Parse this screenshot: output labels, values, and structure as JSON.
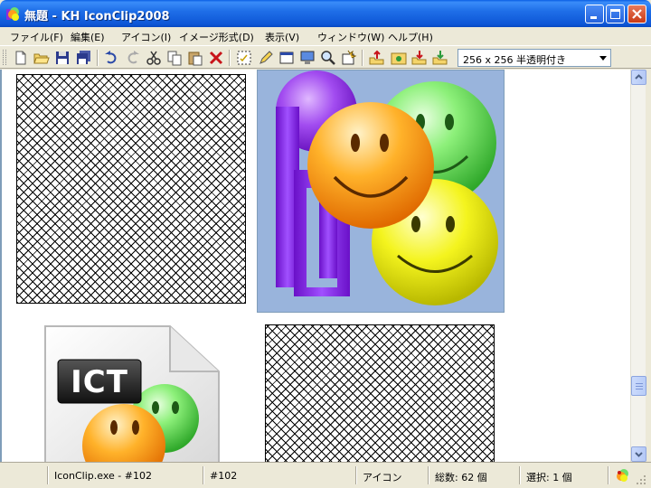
{
  "window": {
    "title": "無題 - KH IconClip2008",
    "minimize_glyph": "_",
    "maximize_glyph": "□",
    "close_glyph": "×"
  },
  "menu": [
    {
      "label": "ファイル(F)"
    },
    {
      "label": "編集(E)"
    },
    {
      "label": "アイコン(I)"
    },
    {
      "label": "イメージ形式(D)"
    },
    {
      "label": "表示(V)"
    },
    {
      "label": "ウィンドウ(W)"
    },
    {
      "label": "ヘルプ(H)"
    }
  ],
  "toolbar": {
    "buttons": [
      {
        "name": "new-file-icon"
      },
      {
        "name": "open-folder-icon"
      },
      {
        "name": "save-icon"
      },
      {
        "name": "save-all-icon"
      },
      {
        "name": "undo-icon"
      },
      {
        "name": "redo-icon"
      },
      {
        "name": "cut-icon"
      },
      {
        "name": "copy-icon"
      },
      {
        "name": "paste-icon"
      },
      {
        "name": "delete-icon"
      },
      {
        "name": "select-icon"
      },
      {
        "name": "pencil-icon"
      },
      {
        "name": "window-icon"
      },
      {
        "name": "monitor-icon"
      },
      {
        "name": "zoom-icon"
      },
      {
        "name": "properties-icon"
      },
      {
        "name": "export-icon"
      },
      {
        "name": "image-icon"
      },
      {
        "name": "import-icon"
      },
      {
        "name": "extract-icon"
      }
    ],
    "size_format": "256 x 256 半透明付き"
  },
  "tiles": [
    {
      "name": "icon-tile-transparent-1"
    },
    {
      "name": "icon-tile-iconclip-smileys"
    },
    {
      "name": "icon-tile-ict-file"
    },
    {
      "name": "icon-tile-transparent-2"
    }
  ],
  "ict_label": "ICT",
  "status": {
    "resource": "IconClip.exe - #102",
    "id": "#102",
    "type": "アイコン",
    "total": "総数: 62 個",
    "selected": "選択: 1 個"
  },
  "colors": {
    "titlebar": "#0d56d6",
    "tile_bg": "#99b4dc",
    "purple": "#8a2ee0",
    "green": "#6ee06a",
    "orange": "#ff9d1c",
    "yellow": "#f2f21a"
  }
}
